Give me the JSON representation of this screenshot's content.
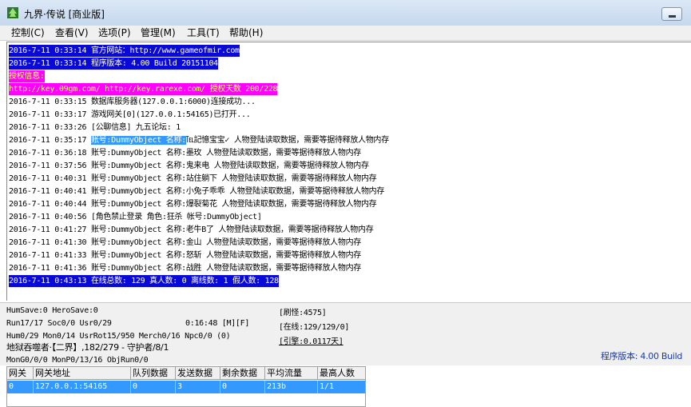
{
  "window": {
    "title": "九界·传说 [商业版]"
  },
  "menu": {
    "items": [
      "控制(C)",
      "查看(V)",
      "选项(P)",
      "管理(M)",
      "工具(T)",
      "帮助(H)"
    ]
  },
  "log": {
    "lines": [
      {
        "text": "2016-7-11 0:33:14 官方网站：http://www.gameofmir.com",
        "style": "sel-blue"
      },
      {
        "text": "2016-7-11 0:33:14 程序版本: 4.00 Build 20151104",
        "style": "sel-blue"
      },
      {
        "text": "授权信息:",
        "style": "sel-magenta"
      },
      {
        "text": "http://key.09gm.com/ http://key.rarexe.com/ 授权天数 200/228",
        "style": "sel-magenta"
      },
      {
        "text": "2016-7-11 0:33:15 数据库服务器(127.0.0.1:6000)连接成功...",
        "style": ""
      },
      {
        "text": "2016-7-11 0:33:17 游戏网关[0](127.0.0.1:54165)已打开...",
        "style": ""
      },
      {
        "text": "2016-7-11 0:33:26 [公聊信息] 九五论坛: 1",
        "style": ""
      },
      {
        "text": "2016-7-11 0:35:17 账号:DummyObject 名称:℡記憶宝宝✓ 人物登陆读取数据，需要等据待释放人物内存",
        "style": "partial"
      },
      {
        "text": "2016-7-11 0:36:18 账号:DummyObject 名称:墨玫 人物登陆读取数据，需要等据待释放人物内存",
        "style": ""
      },
      {
        "text": "2016-7-11 0:37:56 账号:DummyObject 名称:鬼来电 人物登陆读取数据，需要等据待释放人物内存",
        "style": ""
      },
      {
        "text": "2016-7-11 0:40:31 账号:DummyObject 名称:站住躺下 人物登陆读取数据，需要等据待释放人物内存",
        "style": ""
      },
      {
        "text": "2016-7-11 0:40:41 账号:DummyObject 名称:小兔子乖乖 人物登陆读取数据，需要等据待释放人物内存",
        "style": ""
      },
      {
        "text": "2016-7-11 0:40:44 账号:DummyObject 名称:爆裂菊花 人物登陆读取数据，需要等据待释放人物内存",
        "style": ""
      },
      {
        "text": "2016-7-11 0:40:56 [角色禁止登录 角色:狂杀 帐号:DummyObject]",
        "style": ""
      },
      {
        "text": "2016-7-11 0:41:27 账号:DummyObject 名称:老牛B了 人物登陆读取数据，需要等据待释放人物内存",
        "style": ""
      },
      {
        "text": "2016-7-11 0:41:30 账号:DummyObject 名称:金山 人物登陆读取数据，需要等据待释放人物内存",
        "style": ""
      },
      {
        "text": "2016-7-11 0:41:33 账号:DummyObject 名称:怒斩 人物登陆读取数据，需要等据待释放人物内存",
        "style": ""
      },
      {
        "text": "2016-7-11 0:41:36 账号:DummyObject 名称:战胜 人物登陆读取数据，需要等据待释放人物内存",
        "style": ""
      },
      {
        "text": "2016-7-11 0:43:13 在线总数: 129 真人数: 0 离线数: 1 假人数: 128",
        "style": "sel-blue"
      }
    ],
    "partial_line": {
      "prefix": "2016-7-11 0:35:17 ",
      "highlight": "账号:DummyObject 名称:",
      "suffix": "℡記憶宝宝✓ 人物登陆读取数据，需要等据待释放人物内存"
    }
  },
  "status": {
    "l1": "HumSave:0 HeroSave:0",
    "l2": "Run17/17 Soc0/0 Usr0/29",
    "l2b": "0:16:48 [M][F]",
    "l3": "Hum0/29 Mon0/14 UsrRot15/950 Merch0/16 Npc0/0 (0)",
    "l4": "地狱吞噬者·【二界】,182/279 - 守护者/8/1",
    "l5": "MonG0/0/0 MonP0/13/16 ObjRun0/0",
    "r1": "[刷怪:4575]",
    "r2": "[在线:129/129/0]",
    "r3": "[引擎:0.0117天]",
    "version": "程序版本: 4.00 Build"
  },
  "grid": {
    "headers": [
      "网关",
      "网关地址",
      "队列数据",
      "发送数据",
      "剩余数据",
      "平均流量",
      "最高人数"
    ],
    "rows": [
      [
        "0",
        "127.0.0.1:54165",
        "0",
        "3",
        "0",
        "213b",
        "1/1"
      ]
    ]
  },
  "colors": {
    "selection_blue": "#0a0ad6",
    "selection_magenta": "#ff00ff",
    "row_highlight": "#3399ff"
  }
}
